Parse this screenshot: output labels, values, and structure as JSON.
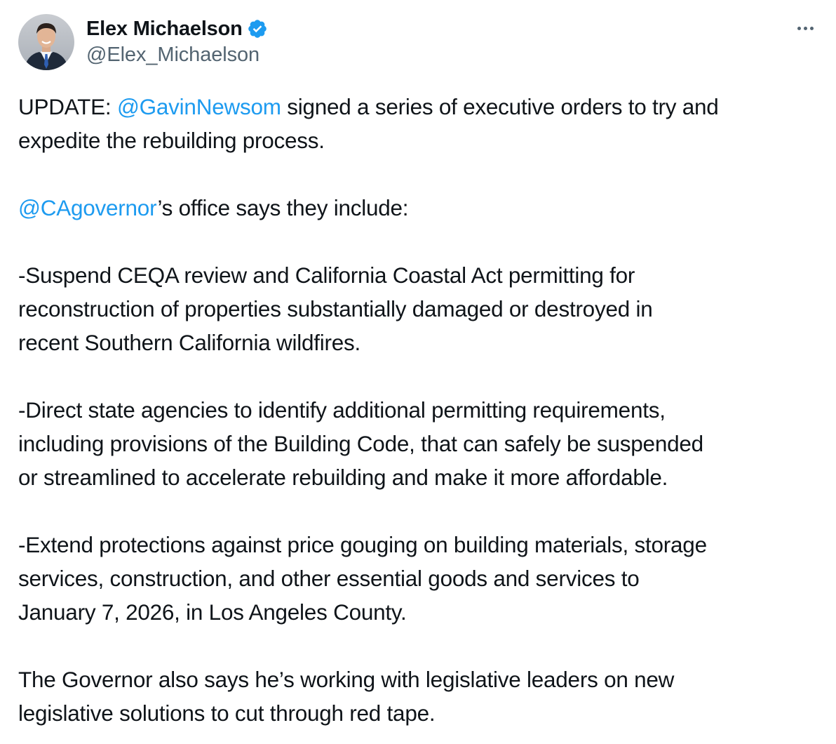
{
  "author": {
    "display_name": "Elex Michaelson",
    "handle": "@Elex_Michaelson",
    "verified": true,
    "verified_icon": "verified-badge-icon",
    "avatar_icon": "avatar-photo"
  },
  "menu": {
    "icon": "more-options-icon"
  },
  "colors": {
    "link": "#1d9bf0",
    "text": "#0f1419",
    "secondary": "#536471",
    "verified": "#1d9bf0"
  },
  "tweet": {
    "p1_prefix": "UPDATE: ",
    "p1_mention": "@GavinNewsom",
    "p1_text_a": " signed a series of executive orders to try and",
    "p1_text_b": "expedite the rebuilding process.",
    "p2_mention": "@CAgovernor",
    "p2_text": "’s office says they include:",
    "b1_l1": "-Suspend CEQA review and California Coastal Act permitting for",
    "b1_l2": "reconstruction of properties substantially damaged or destroyed in",
    "b1_l3": "recent Southern California wildfires.",
    "b2_l1": "-Direct state agencies to identify additional permitting requirements,",
    "b2_l2": "including provisions of the Building Code, that can safely be suspended",
    "b2_l3": "or streamlined to accelerate rebuilding and make it more affordable.",
    "b3_l1": "-Extend protections against price gouging on building materials, storage",
    "b3_l2": "services, construction, and other essential goods and services to",
    "b3_l3": "January 7, 2026, in Los Angeles County.",
    "p4_l1": "The Governor also says he’s working with legislative leaders on new",
    "p4_l2": "legislative solutions to cut through red tape."
  }
}
